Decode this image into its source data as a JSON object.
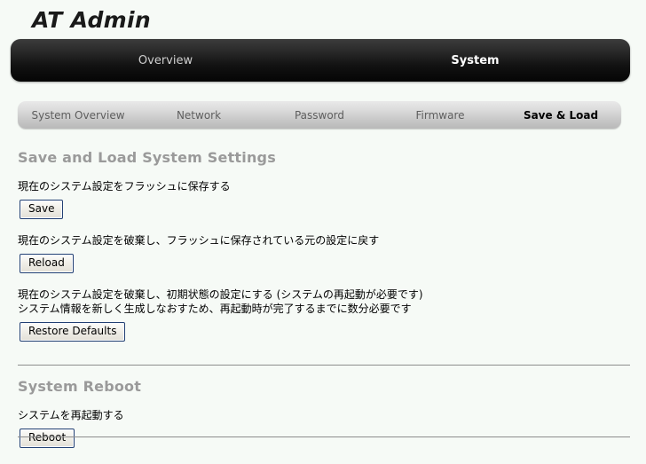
{
  "brand": {
    "title": "AT Admin"
  },
  "main_nav": {
    "items": [
      {
        "label": "Overview",
        "active": false
      },
      {
        "label": "System",
        "active": true
      }
    ]
  },
  "sub_nav": {
    "items": [
      {
        "label": "System Overview",
        "active": false
      },
      {
        "label": "Network",
        "active": false
      },
      {
        "label": "Password",
        "active": false
      },
      {
        "label": "Firmware",
        "active": false
      },
      {
        "label": "Save & Load",
        "active": true
      }
    ]
  },
  "save_load_section": {
    "heading": "Save and Load System Settings",
    "save": {
      "description": "現在のシステム設定をフラッシュに保存する",
      "button_label": "Save"
    },
    "reload": {
      "description": "現在のシステム設定を破棄し、フラッシュに保存されている元の設定に戻す",
      "button_label": "Reload"
    },
    "restore_defaults": {
      "description_line1": "現在のシステム設定を破棄し、初期状態の設定にする (システムの再起動が必要です)",
      "description_line2": "システム情報を新しく生成しなおすため、再起動時が完了するまでに数分必要です",
      "button_label": "Restore Defaults"
    }
  },
  "reboot_section": {
    "heading": "System Reboot",
    "description": "システムを再起動する",
    "button_label": "Reboot"
  },
  "colors": {
    "page_background": "#f6faf6",
    "nav_dark": "#121212",
    "subnav_gray": "#c4c4c4",
    "heading_gray": "#9a9a9a",
    "button_border": "#213f73",
    "rule_gray": "#8d8d8d"
  }
}
